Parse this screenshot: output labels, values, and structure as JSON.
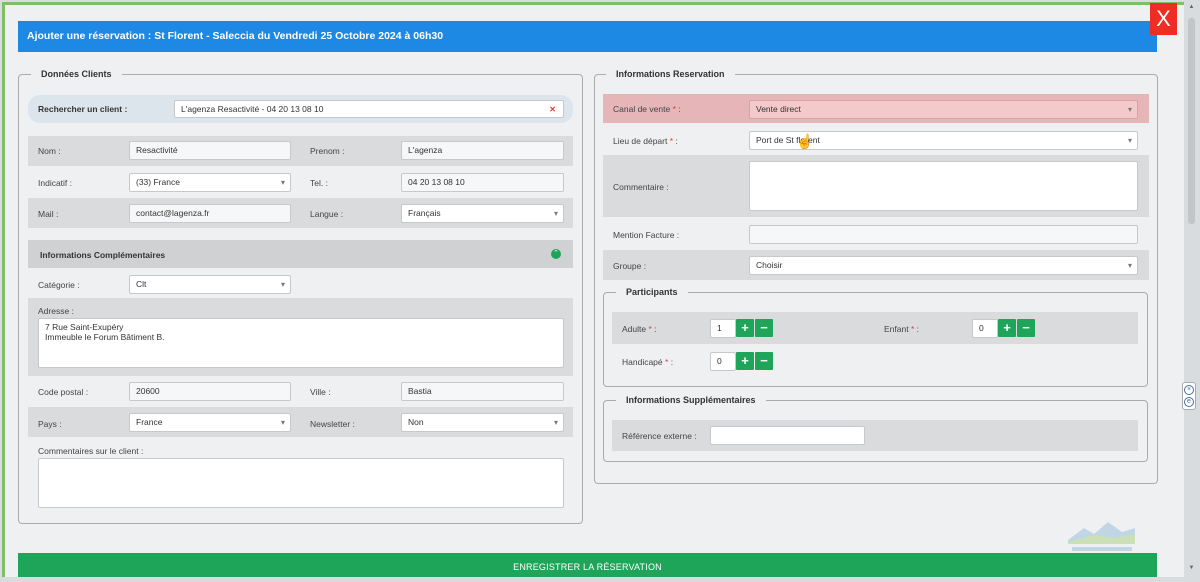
{
  "modal": {
    "title": "Ajouter une réservation : St Florent - Saleccia du Vendredi 25 Octobre 2024 à 06h30",
    "close_label": "X"
  },
  "client": {
    "legend": "Données Clients",
    "search_label": "Rechercher un client :",
    "search_value": "L'agenza Resactivité - 04 20 13 08 10",
    "clear_label": "✕",
    "nom_label": "Nom :",
    "nom_value": "Resactivité",
    "prenom_label": "Prenom :",
    "prenom_value": "L'agenza",
    "indicatif_label": "Indicatif :",
    "indicatif_value": "(33) France",
    "tel_label": "Tel. :",
    "tel_value": "04 20 13 08 10",
    "mail_label": "Mail :",
    "mail_value": "contact@lagenza.fr",
    "langue_label": "Langue :",
    "langue_value": "Français",
    "info_comp_title": "Informations Complémentaires",
    "categorie_label": "Catégorie :",
    "categorie_value": "Clt",
    "adresse_label": "Adresse :",
    "adresse_line1": "7 Rue Saint-Exupéry",
    "adresse_line2": "Immeuble le Forum Bâtiment B.",
    "cp_label": "Code postal :",
    "cp_value": "20600",
    "ville_label": "Ville :",
    "ville_value": "Bastia",
    "pays_label": "Pays :",
    "pays_value": "France",
    "newsletter_label": "Newsletter :",
    "newsletter_value": "Non",
    "comments_label": "Commentaires sur le client :"
  },
  "reservation": {
    "legend": "Informations Reservation",
    "canal_label": "Canal de vente",
    "canal_value": "Vente direct",
    "lieu_label": "Lieu de départ",
    "lieu_value": "Port de St florent",
    "commentaire_label": "Commentaire :",
    "mention_label": "Mention Facture :",
    "groupe_label": "Groupe :",
    "groupe_value": "Choisir",
    "required_mark": "*",
    "colon": " :",
    "participants": {
      "legend": "Participants",
      "adulte_label": "Adulte",
      "adulte_value": "1",
      "enfant_label": "Enfant",
      "enfant_value": "0",
      "handicape_label": "Handicapé",
      "handicape_value": "0",
      "plus": "+",
      "minus": "−"
    },
    "supp": {
      "legend": "Informations Supplémentaires",
      "ref_label": "Référence externe :"
    }
  },
  "save_label": "ENREGISTRER LA RÉSERVATION",
  "colors": {
    "header": "#1e88e5",
    "close": "#ee2d24",
    "green": "#1fa55a",
    "highlight": "#e9b8ba"
  }
}
